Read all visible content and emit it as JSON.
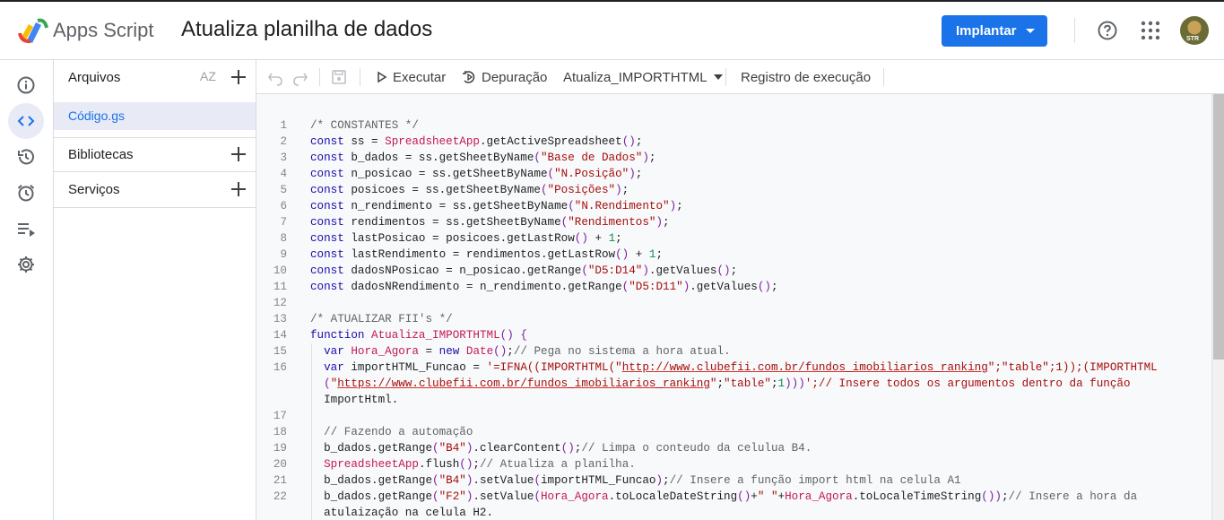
{
  "header": {
    "app_name": "Apps Script",
    "project_title": "Atualiza planilha de dados",
    "deploy_label": "Implantar",
    "avatar_badge": "STR"
  },
  "files_panel": {
    "files_label": "Arquivos",
    "sort_label": "AZ",
    "file_name": "Código.gs",
    "libraries_label": "Bibliotecas",
    "services_label": "Serviços"
  },
  "toolbar": {
    "run_label": "Executar",
    "debug_label": "Depuração",
    "function_name": "Atualiza_IMPORTHTML",
    "exec_log_label": "Registro de execução"
  },
  "rail_icons": [
    "info-icon",
    "code-icon",
    "history-icon",
    "alarm-icon",
    "executions-icon",
    "settings-icon"
  ],
  "editor": {
    "lines": [
      {
        "n": "1",
        "t": "/* CONSTANTES */"
      },
      {
        "n": "2",
        "t": "const ss = SpreadsheetApp.getActiveSpreadsheet();"
      },
      {
        "n": "3",
        "t": "const b_dados = ss.getSheetByName(\"Base de Dados\");"
      },
      {
        "n": "4",
        "t": "const n_posicao = ss.getSheetByName(\"N.Posição\");"
      },
      {
        "n": "5",
        "t": "const posicoes = ss.getSheetByName(\"Posições\");"
      },
      {
        "n": "6",
        "t": "const n_rendimento = ss.getSheetByName(\"N.Rendimento\");"
      },
      {
        "n": "7",
        "t": "const rendimentos = ss.getSheetByName(\"Rendimentos\");"
      },
      {
        "n": "8",
        "t": "const lastPosicao = posicoes.getLastRow() + 1;"
      },
      {
        "n": "9",
        "t": "const lastRendimento = rendimentos.getLastRow() + 1;"
      },
      {
        "n": "10",
        "t": "const dadosNPosicao = n_posicao.getRange(\"D5:D14\").getValues();"
      },
      {
        "n": "11",
        "t": "const dadosNRendimento = n_rendimento.getRange(\"D5:D11\").getValues();"
      },
      {
        "n": "12",
        "t": ""
      },
      {
        "n": "13",
        "t": "/* ATUALIZAR FII's */"
      },
      {
        "n": "14",
        "t": "function Atualiza_IMPORTHTML() {"
      },
      {
        "n": "15",
        "t": "  var Hora_Agora = new Date();// Pega no sistema a hora atual."
      },
      {
        "n": "16",
        "t": "  var importHTML_Funcao = '=IFNA((IMPORTHTML(\"http://www.clubefii.com.br/fundos_imobiliarios_ranking\";\"table\";1));(IMPORTHTML"
      },
      {
        "n": "",
        "t": "  (\"https://www.clubefii.com.br/fundos_imobiliarios_ranking\";\"table\";1)))';// Insere todos os argumentos dentro da função"
      },
      {
        "n": "",
        "t": "  ImportHtml."
      },
      {
        "n": "17",
        "t": ""
      },
      {
        "n": "18",
        "t": "  // Fazendo a automação"
      },
      {
        "n": "19",
        "t": "  b_dados.getRange(\"B4\").clearContent();// Limpa o conteudo da celulua B4."
      },
      {
        "n": "20",
        "t": "  SpreadsheetApp.flush();// Atualiza a planilha."
      },
      {
        "n": "21",
        "t": "  b_dados.getRange(\"B4\").setValue(importHTML_Funcao);// Insere a função import html na celula A1"
      },
      {
        "n": "22",
        "t": "  b_dados.getRange(\"F2\").setValue(Hora_Agora.toLocaleDateString()+\" \"+Hora_Agora.toLocaleTimeString());// Insere a hora da"
      },
      {
        "n": "",
        "t": "  atulaização na celula H2."
      }
    ]
  }
}
